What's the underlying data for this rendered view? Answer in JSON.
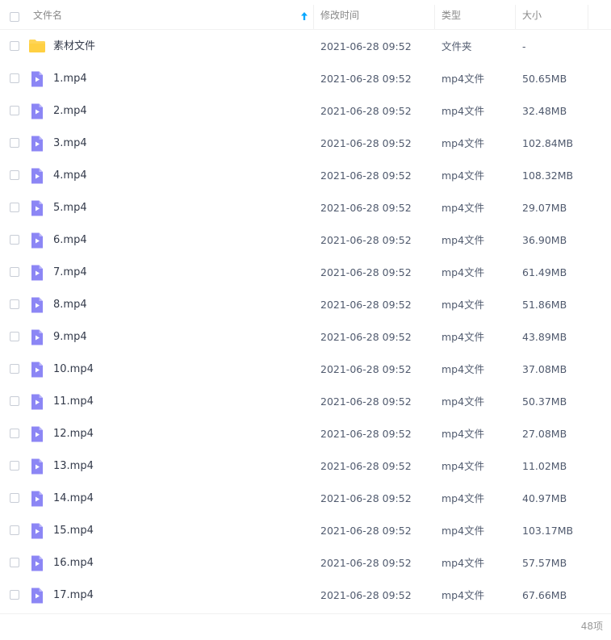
{
  "header": {
    "name_label": "文件名",
    "mtime_label": "修改时间",
    "type_label": "类型",
    "size_label": "大小"
  },
  "colors": {
    "folder": "#ffd556",
    "video": "#8c86f5",
    "sort_arrow": "#06a7ff"
  },
  "files": [
    {
      "name": "素材文件",
      "mtime": "2021-06-28 09:52",
      "type": "文件夹",
      "size": "-",
      "icon": "folder-icon"
    },
    {
      "name": "1.mp4",
      "mtime": "2021-06-28 09:52",
      "type": "mp4文件",
      "size": "50.65MB",
      "icon": "video-file-icon"
    },
    {
      "name": "2.mp4",
      "mtime": "2021-06-28 09:52",
      "type": "mp4文件",
      "size": "32.48MB",
      "icon": "video-file-icon"
    },
    {
      "name": "3.mp4",
      "mtime": "2021-06-28 09:52",
      "type": "mp4文件",
      "size": "102.84MB",
      "icon": "video-file-icon"
    },
    {
      "name": "4.mp4",
      "mtime": "2021-06-28 09:52",
      "type": "mp4文件",
      "size": "108.32MB",
      "icon": "video-file-icon"
    },
    {
      "name": "5.mp4",
      "mtime": "2021-06-28 09:52",
      "type": "mp4文件",
      "size": "29.07MB",
      "icon": "video-file-icon"
    },
    {
      "name": "6.mp4",
      "mtime": "2021-06-28 09:52",
      "type": "mp4文件",
      "size": "36.90MB",
      "icon": "video-file-icon"
    },
    {
      "name": "7.mp4",
      "mtime": "2021-06-28 09:52",
      "type": "mp4文件",
      "size": "61.49MB",
      "icon": "video-file-icon"
    },
    {
      "name": "8.mp4",
      "mtime": "2021-06-28 09:52",
      "type": "mp4文件",
      "size": "51.86MB",
      "icon": "video-file-icon"
    },
    {
      "name": "9.mp4",
      "mtime": "2021-06-28 09:52",
      "type": "mp4文件",
      "size": "43.89MB",
      "icon": "video-file-icon"
    },
    {
      "name": "10.mp4",
      "mtime": "2021-06-28 09:52",
      "type": "mp4文件",
      "size": "37.08MB",
      "icon": "video-file-icon"
    },
    {
      "name": "11.mp4",
      "mtime": "2021-06-28 09:52",
      "type": "mp4文件",
      "size": "50.37MB",
      "icon": "video-file-icon"
    },
    {
      "name": "12.mp4",
      "mtime": "2021-06-28 09:52",
      "type": "mp4文件",
      "size": "27.08MB",
      "icon": "video-file-icon"
    },
    {
      "name": "13.mp4",
      "mtime": "2021-06-28 09:52",
      "type": "mp4文件",
      "size": "11.02MB",
      "icon": "video-file-icon"
    },
    {
      "name": "14.mp4",
      "mtime": "2021-06-28 09:52",
      "type": "mp4文件",
      "size": "40.97MB",
      "icon": "video-file-icon"
    },
    {
      "name": "15.mp4",
      "mtime": "2021-06-28 09:52",
      "type": "mp4文件",
      "size": "103.17MB",
      "icon": "video-file-icon"
    },
    {
      "name": "16.mp4",
      "mtime": "2021-06-28 09:52",
      "type": "mp4文件",
      "size": "57.57MB",
      "icon": "video-file-icon"
    },
    {
      "name": "17.mp4",
      "mtime": "2021-06-28 09:52",
      "type": "mp4文件",
      "size": "67.66MB",
      "icon": "video-file-icon"
    }
  ],
  "footer": {
    "count": "48项"
  }
}
